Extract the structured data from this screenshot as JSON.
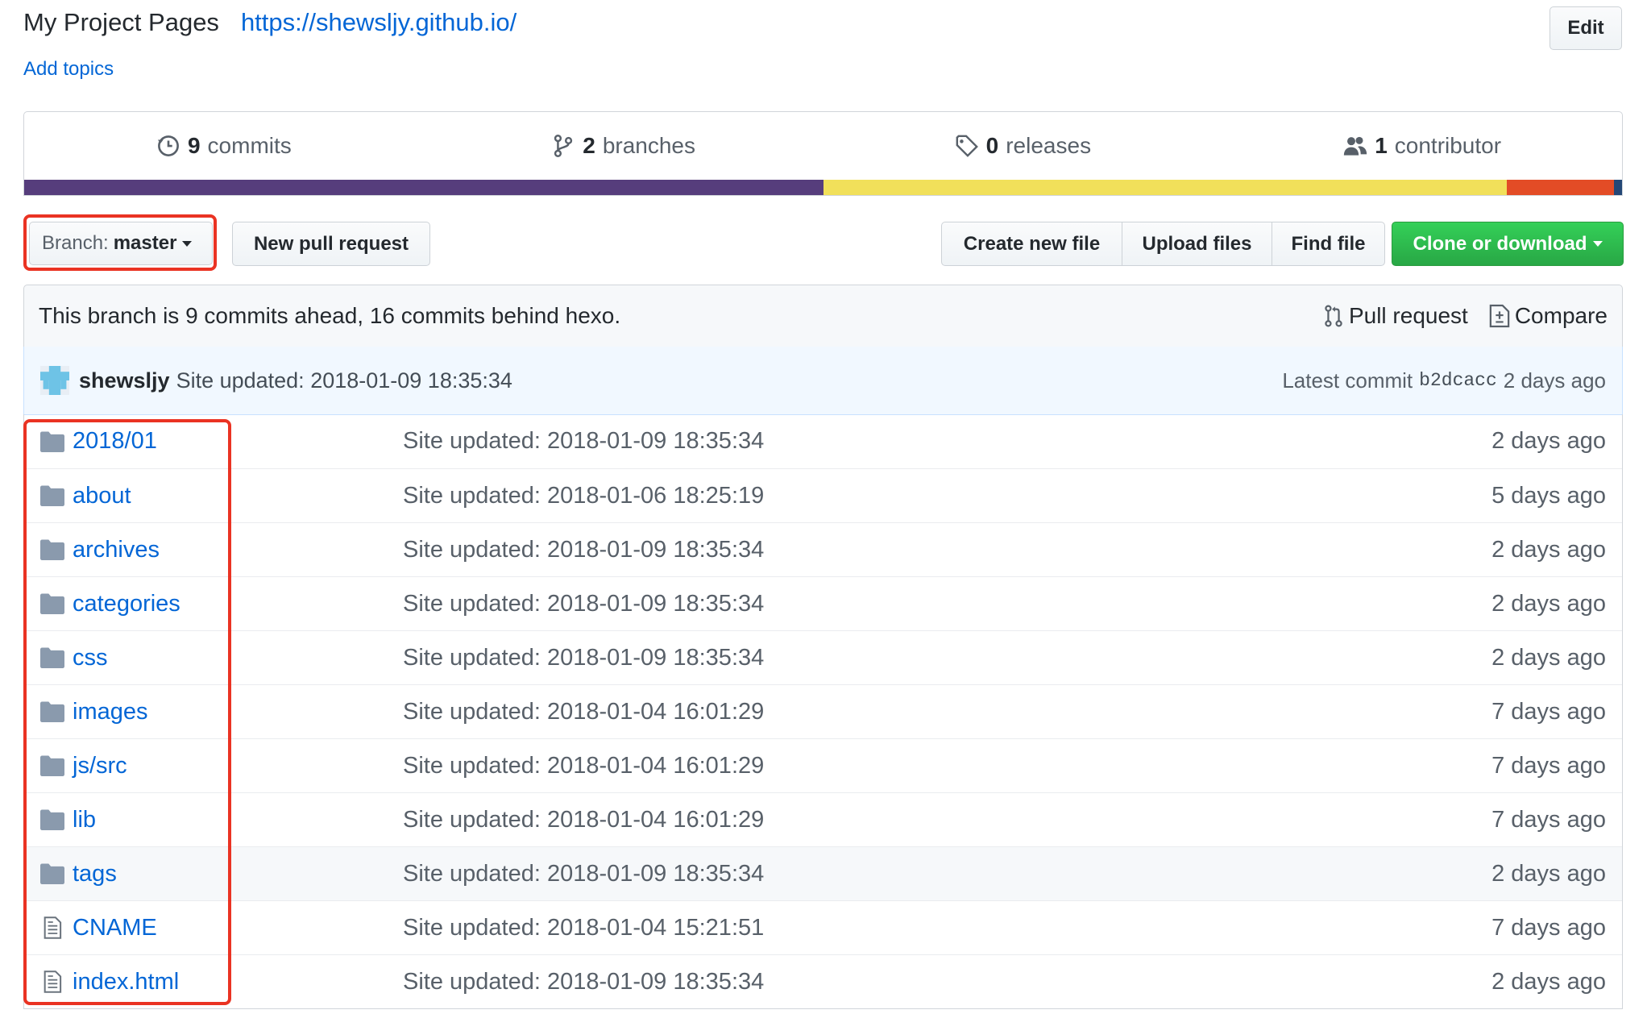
{
  "repo": {
    "description": "My Project Pages",
    "url": "https://shewsljy.github.io/",
    "add_topics": "Add topics",
    "edit": "Edit"
  },
  "summary": {
    "commits_num": "9",
    "commits_label": "commits",
    "branches_num": "2",
    "branches_label": "branches",
    "releases_num": "0",
    "releases_label": "releases",
    "contributors_num": "1",
    "contributors_label": "contributor"
  },
  "languages": [
    {
      "color": "#563d7c",
      "fraction": 0.5
    },
    {
      "color": "#f1e05a",
      "fraction": 0.428
    },
    {
      "color": "#e34c26",
      "fraction": 0.067
    },
    {
      "color": "#244776",
      "fraction": 0.005
    }
  ],
  "toolbar": {
    "branch_label": "Branch:",
    "branch_value": "master",
    "new_pull_request": "New pull request",
    "create_new_file": "Create new file",
    "upload_files": "Upload files",
    "find_file": "Find file",
    "clone_or_download": "Clone or download"
  },
  "branch_info": {
    "message": "This branch is 9 commits ahead, 16 commits behind hexo.",
    "pull_request": "Pull request",
    "compare": "Compare"
  },
  "latest_commit": {
    "author": "shewsljy",
    "message": "Site updated: 2018-01-09 18:35:34",
    "latest_label": "Latest commit",
    "sha": "b2dcacc",
    "age": "2 days ago"
  },
  "files": [
    {
      "type": "folder",
      "name": "2018/01",
      "message": "Site updated: 2018-01-09 18:35:34",
      "age": "2 days ago"
    },
    {
      "type": "folder",
      "name": "about",
      "message": "Site updated: 2018-01-06 18:25:19",
      "age": "5 days ago"
    },
    {
      "type": "folder",
      "name": "archives",
      "message": "Site updated: 2018-01-09 18:35:34",
      "age": "2 days ago"
    },
    {
      "type": "folder",
      "name": "categories",
      "message": "Site updated: 2018-01-09 18:35:34",
      "age": "2 days ago"
    },
    {
      "type": "folder",
      "name": "css",
      "message": "Site updated: 2018-01-09 18:35:34",
      "age": "2 days ago"
    },
    {
      "type": "folder",
      "name": "images",
      "message": "Site updated: 2018-01-04 16:01:29",
      "age": "7 days ago"
    },
    {
      "type": "folder",
      "name": "js/src",
      "message": "Site updated: 2018-01-04 16:01:29",
      "age": "7 days ago"
    },
    {
      "type": "folder",
      "name": "lib",
      "message": "Site updated: 2018-01-04 16:01:29",
      "age": "7 days ago"
    },
    {
      "type": "folder",
      "name": "tags",
      "message": "Site updated: 2018-01-09 18:35:34",
      "age": "2 days ago"
    },
    {
      "type": "file",
      "name": "CNAME",
      "message": "Site updated: 2018-01-04 15:21:51",
      "age": "7 days ago"
    },
    {
      "type": "file",
      "name": "index.html",
      "message": "Site updated: 2018-01-09 18:35:34",
      "age": "2 days ago"
    }
  ],
  "highlight": {
    "red": "#ea3323"
  }
}
